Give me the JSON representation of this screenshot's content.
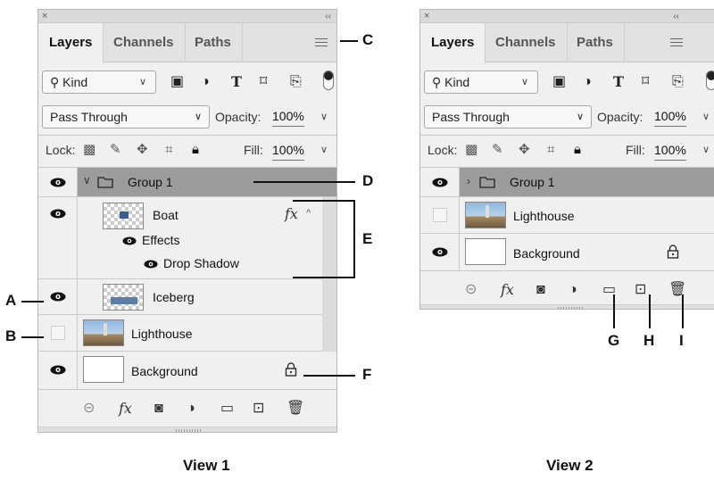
{
  "panel_titlebar": {
    "close": "×",
    "collapse": "‹‹"
  },
  "tabs": [
    "Layers",
    "Channels",
    "Paths"
  ],
  "filter": {
    "kind_label": "Kind",
    "kind_chevron": "∨"
  },
  "blend": {
    "mode": "Pass Through",
    "chevron": "∨",
    "opacity_label": "Opacity:",
    "opacity_value": "100%"
  },
  "lock": {
    "label": "Lock:",
    "fill_label": "Fill:",
    "fill_value": "100%"
  },
  "view1": {
    "layers": [
      {
        "name": "Group 1",
        "visible": true,
        "type": "group"
      },
      {
        "name": "Boat",
        "visible": true,
        "type": "layer",
        "fx": "fx"
      },
      {
        "name": "Effects",
        "type": "effects"
      },
      {
        "name": "Drop Shadow",
        "type": "effect"
      },
      {
        "name": "Iceberg",
        "visible": true,
        "type": "layer"
      },
      {
        "name": "Lighthouse",
        "visible": false,
        "type": "layer"
      },
      {
        "name": "Background",
        "visible": true,
        "type": "layer",
        "locked": true
      }
    ]
  },
  "view2": {
    "layers": [
      {
        "name": "Group 1",
        "visible": true,
        "type": "group"
      },
      {
        "name": "Lighthouse",
        "visible": false,
        "type": "layer"
      },
      {
        "name": "Background",
        "visible": true,
        "type": "layer",
        "locked": true
      }
    ]
  },
  "bottom_bar": {
    "fx": "fx"
  },
  "callouts": {
    "A": "A",
    "B": "B",
    "C": "C",
    "D": "D",
    "E": "E",
    "F": "F",
    "G": "G",
    "H": "H",
    "I": "I"
  },
  "captions": {
    "view1": "View 1",
    "view2": "View 2"
  }
}
